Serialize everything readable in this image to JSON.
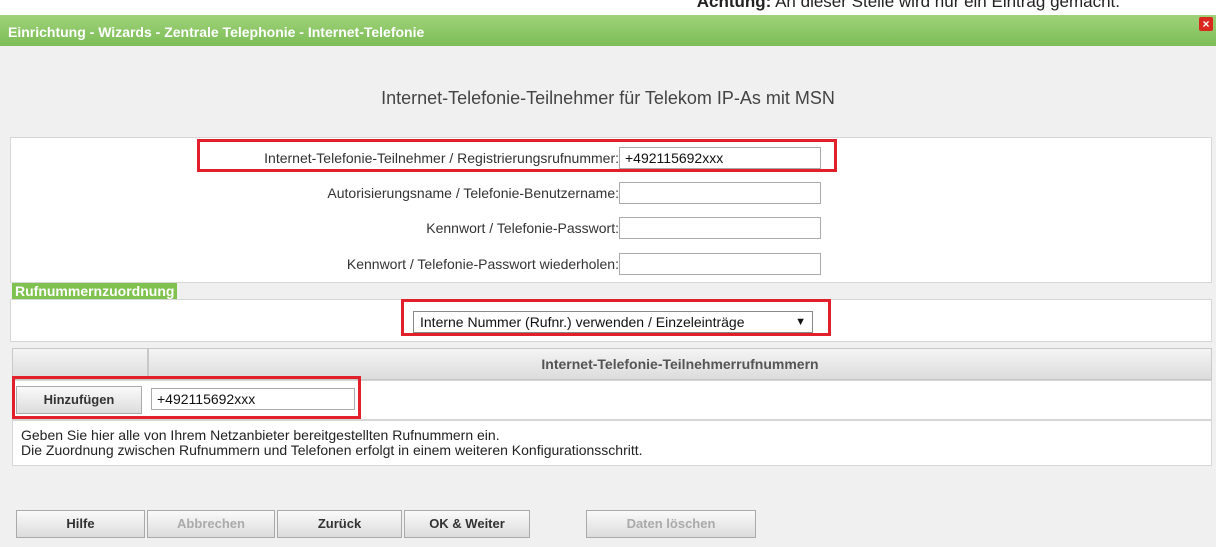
{
  "note": {
    "bold": "Achtung:",
    "text": " An dieser Stelle wird nur ein Eintrag gemacht."
  },
  "window": {
    "title": "Einrichtung - Wizards - Zentrale Telephonie - Internet-Telefonie",
    "close": "×"
  },
  "heading": "Internet-Telefonie-Teilnehmer für Telekom IP-As mit MSN",
  "form": {
    "reg_label": "Internet-Telefonie-Teilnehmer / Registrierungsrufnummer:",
    "reg_value": "+492115692xxx",
    "auth_label": "Autorisierungsname / Telefonie-Benutzername:",
    "auth_value": "",
    "pw_label": "Kennwort / Telefonie-Passwort:",
    "pw_value": "",
    "pw2_label": "Kennwort / Telefonie-Passwort wiederholen:",
    "pw2_value": ""
  },
  "assignment": {
    "section_label": "Rufnummernzuordnung",
    "select_value": "Interne Nummer (Rufnr.) verwenden / Einzeleinträge",
    "select_arrow": "▼"
  },
  "table": {
    "col1_header": "",
    "col2_header": "Internet-Telefonie-Teilnehmerrufnummern",
    "add_button": "Hinzufügen",
    "number_value": "+492115692xxx"
  },
  "info": {
    "line1": "Geben Sie hier alle von Ihrem Netzanbieter bereitgestellten Rufnummern ein.",
    "line2": "Die Zuordnung zwischen Rufnummern und Telefonen erfolgt in einem weiteren Konfigurationsschritt."
  },
  "buttons": {
    "help": "Hilfe",
    "cancel": "Abbrechen",
    "back": "Zurück",
    "ok_next": "OK & Weiter",
    "delete_data": "Daten löschen"
  },
  "colors": {
    "title_green": "#7cbd56",
    "highlight_red": "#e0202a",
    "section_green": "#80c24f"
  }
}
